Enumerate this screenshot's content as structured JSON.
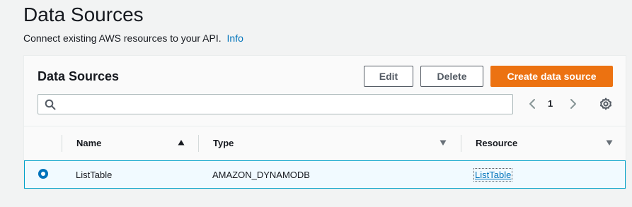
{
  "header": {
    "title": "Data Sources",
    "description": "Connect existing AWS resources to your API.",
    "info_link": "Info"
  },
  "panel": {
    "title": "Data Sources",
    "buttons": {
      "edit": "Edit",
      "delete": "Delete",
      "create": "Create data source"
    },
    "search": {
      "value": "",
      "placeholder": ""
    },
    "pagination": {
      "current_page": "1"
    },
    "table": {
      "columns": [
        {
          "label": "Name",
          "sort": "ascending"
        },
        {
          "label": "Type",
          "sort": "none"
        },
        {
          "label": "Resource",
          "sort": "none"
        }
      ],
      "rows": [
        {
          "selected": true,
          "name": "ListTable",
          "type": "AMAZON_DYNAMODB",
          "resource": "ListTable"
        }
      ]
    }
  },
  "colors": {
    "primary_button": "#ec7211",
    "link": "#0073bb",
    "selected_row_border": "#00a1c9",
    "selected_row_background": "#f1faff"
  },
  "icons": {
    "search": "search-icon",
    "prev": "chevron-left-icon",
    "next": "chevron-right-icon",
    "settings": "gear-icon",
    "sort_asc": "sort-ascending-icon",
    "sort_none": "sort-caret-down-icon"
  }
}
